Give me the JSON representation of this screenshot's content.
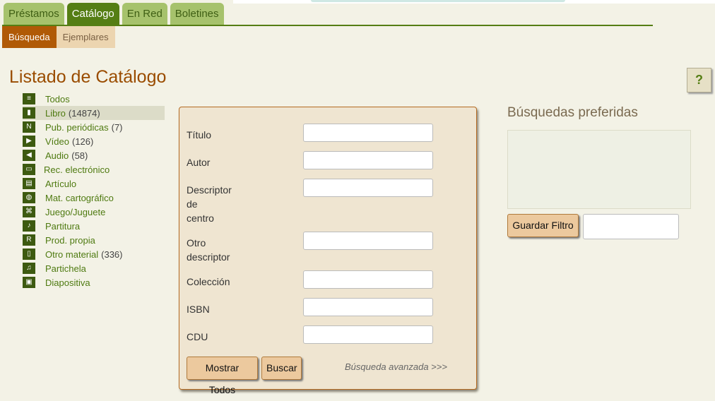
{
  "tabs": [
    {
      "label": "Préstamos"
    },
    {
      "label": "Catálogo"
    },
    {
      "label": "En Red"
    },
    {
      "label": "Boletines"
    }
  ],
  "subtabs": [
    {
      "label": "Búsqueda"
    },
    {
      "label": "Ejemplares"
    }
  ],
  "page_title": "Listado de Catálogo",
  "help_label": "?",
  "categories": [
    {
      "label": "Todos",
      "count": "",
      "icon": "stack-icon"
    },
    {
      "label": "Libro",
      "count": "(14874)",
      "icon": "book-icon"
    },
    {
      "label": "Pub. periódicas",
      "count": "(7)",
      "icon": "newspaper-icon"
    },
    {
      "label": "Vídeo",
      "count": "(126)",
      "icon": "play-icon"
    },
    {
      "label": "Audio",
      "count": "(58)",
      "icon": "speaker-icon"
    },
    {
      "label": "Rec. electrónico",
      "count": "",
      "icon": "monitor-icon"
    },
    {
      "label": "Artículo",
      "count": "",
      "icon": "article-icon"
    },
    {
      "label": "Mat. cartográfico",
      "count": "",
      "icon": "globe-icon"
    },
    {
      "label": "Juego/Juguete",
      "count": "",
      "icon": "gamepad-icon"
    },
    {
      "label": "Partitura",
      "count": "",
      "icon": "music-note-icon"
    },
    {
      "label": "Prod. propia",
      "count": "",
      "icon": "r-letter-icon"
    },
    {
      "label": "Otro material",
      "count": "(336)",
      "icon": "box-icon"
    },
    {
      "label": "Partichela",
      "count": "",
      "icon": "double-note-icon"
    },
    {
      "label": "Diapositiva",
      "count": "",
      "icon": "projector-icon"
    }
  ],
  "search_fields": [
    {
      "label": "Título",
      "value": ""
    },
    {
      "label": "Autor",
      "value": ""
    },
    {
      "label": "Descriptor\nde\ncentro",
      "value": ""
    },
    {
      "label": "Otro\ndescriptor",
      "value": ""
    },
    {
      "label": "Colección",
      "value": ""
    },
    {
      "label": "ISBN",
      "value": ""
    },
    {
      "label": "CDU",
      "value": ""
    }
  ],
  "buttons": {
    "show_all": "Mostrar Todos",
    "search": "Buscar",
    "advanced": "Búsqueda avanzada >>>",
    "save_filter": "Guardar Filtro"
  },
  "favorites": {
    "title": "Búsquedas preferidas",
    "filter_name_value": ""
  },
  "colors": {
    "tab_active": "#557e14",
    "tab_inactive": "#a6c26c",
    "subtab_active": "#b05a06",
    "title": "#9a4c00",
    "link": "#4e7a10"
  }
}
